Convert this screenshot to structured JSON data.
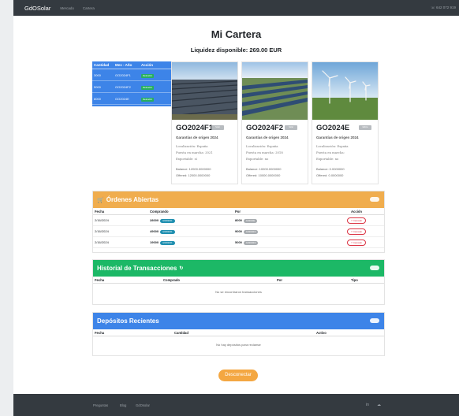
{
  "nav": {
    "brand": "GdOSolar",
    "links": [
      "Mercado",
      "Cartera"
    ],
    "phone": "☏ 642 072 919"
  },
  "page": {
    "title": "Mi Cartera",
    "balance": "Liquidez disponible: 269.00 EUR"
  },
  "portfolio_table": {
    "headers": [
      "Cantidad",
      "Mes - Año",
      "Acción"
    ],
    "rows": [
      {
        "qty": "3000",
        "code": "GO2024F1",
        "action": "Redención"
      },
      {
        "qty": "5000",
        "code": "GO2024F2",
        "action": "Redención"
      },
      {
        "qty": "8000",
        "code": "GO2024E",
        "action": "Redención"
      }
    ]
  },
  "cards": [
    {
      "name": "GO2024F1",
      "badge": "Solar",
      "subtitle": "Garantías de origen 2024",
      "location": "Localización: España",
      "start": "Puesta en marcha: 2021",
      "exportable": "Exportable: sí",
      "balance": "Balance: 12000.0000000",
      "offered": "Offered: 12000.0000000"
    },
    {
      "name": "GO2024F2",
      "badge": "Solar",
      "subtitle": "Garantías de origen 2024",
      "location": "Localización: España",
      "start": "Puesta en marcha: 2018",
      "exportable": "Exportable: no",
      "balance": "Balance: 10000.0000000",
      "offered": "Offered: 10000.0000000"
    },
    {
      "name": "GO2024E",
      "badge": "Eólica",
      "subtitle": "Garantías de origen 2024",
      "location": "Localización: España",
      "start": "Puesta en marcha:",
      "exportable": "Exportable: no",
      "balance": "Balance: 0.0000000",
      "offered": "Offered: 0.0000000"
    }
  ],
  "orders": {
    "title": "Órdenes Abiertas",
    "headers": [
      "Fecha",
      "Comprando",
      "Por",
      "Acción"
    ],
    "rows": [
      {
        "date": "2/16/2024",
        "buy_qty": "28000",
        "buy_code": "GO2024F1",
        "for_qty": "8000",
        "for_code": "GO2024E",
        "action": "Cancelar"
      },
      {
        "date": "2/16/2024",
        "buy_qty": "49000",
        "buy_code": "GO2024F1",
        "for_qty": "9000",
        "for_code": "GO2024F2",
        "action": "Cancelar"
      },
      {
        "date": "2/16/2024",
        "buy_qty": "19000",
        "buy_code": "GO2024F1",
        "for_qty": "5000",
        "for_code": "GO2024F2",
        "action": "Cancelar"
      }
    ]
  },
  "transactions": {
    "title": "Historial de Transacciones",
    "headers": [
      "Fecha",
      "Comprado",
      "Por",
      "Tipo"
    ],
    "empty": "No se encontraron transacciones"
  },
  "deposits": {
    "title": "Depósitos Recientes",
    "headers": [
      "Fecha",
      "Cantidad",
      "Activo"
    ],
    "empty": "No hay depósitos para reclamar"
  },
  "disconnect_label": "Desconectar",
  "footer": {
    "links": [
      "Preguntas",
      "Blog",
      "GdOsolar"
    ]
  },
  "colors": {
    "orders": "#f0ad4e",
    "transactions": "#1cb866",
    "deposits": "#3d84e8",
    "portfolio": "#3d84e8"
  },
  "icons": {
    "orders": "cart-icon",
    "transactions": "refresh-icon",
    "footer": [
      "linkedin-icon",
      "twitter-icon"
    ]
  }
}
